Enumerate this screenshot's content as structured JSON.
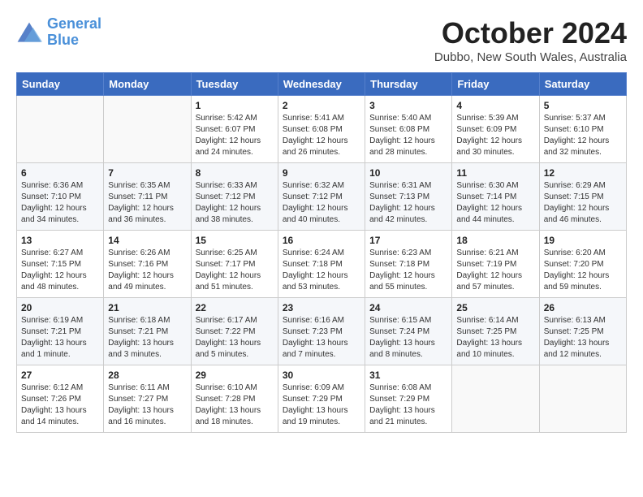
{
  "logo": {
    "line1": "General",
    "line2": "Blue"
  },
  "title": "October 2024",
  "location": "Dubbo, New South Wales, Australia",
  "headers": [
    "Sunday",
    "Monday",
    "Tuesday",
    "Wednesday",
    "Thursday",
    "Friday",
    "Saturday"
  ],
  "weeks": [
    [
      {
        "day": "",
        "sunrise": "",
        "sunset": "",
        "daylight": ""
      },
      {
        "day": "",
        "sunrise": "",
        "sunset": "",
        "daylight": ""
      },
      {
        "day": "1",
        "sunrise": "Sunrise: 5:42 AM",
        "sunset": "Sunset: 6:07 PM",
        "daylight": "Daylight: 12 hours and 24 minutes."
      },
      {
        "day": "2",
        "sunrise": "Sunrise: 5:41 AM",
        "sunset": "Sunset: 6:08 PM",
        "daylight": "Daylight: 12 hours and 26 minutes."
      },
      {
        "day": "3",
        "sunrise": "Sunrise: 5:40 AM",
        "sunset": "Sunset: 6:08 PM",
        "daylight": "Daylight: 12 hours and 28 minutes."
      },
      {
        "day": "4",
        "sunrise": "Sunrise: 5:39 AM",
        "sunset": "Sunset: 6:09 PM",
        "daylight": "Daylight: 12 hours and 30 minutes."
      },
      {
        "day": "5",
        "sunrise": "Sunrise: 5:37 AM",
        "sunset": "Sunset: 6:10 PM",
        "daylight": "Daylight: 12 hours and 32 minutes."
      }
    ],
    [
      {
        "day": "6",
        "sunrise": "Sunrise: 6:36 AM",
        "sunset": "Sunset: 7:10 PM",
        "daylight": "Daylight: 12 hours and 34 minutes."
      },
      {
        "day": "7",
        "sunrise": "Sunrise: 6:35 AM",
        "sunset": "Sunset: 7:11 PM",
        "daylight": "Daylight: 12 hours and 36 minutes."
      },
      {
        "day": "8",
        "sunrise": "Sunrise: 6:33 AM",
        "sunset": "Sunset: 7:12 PM",
        "daylight": "Daylight: 12 hours and 38 minutes."
      },
      {
        "day": "9",
        "sunrise": "Sunrise: 6:32 AM",
        "sunset": "Sunset: 7:12 PM",
        "daylight": "Daylight: 12 hours and 40 minutes."
      },
      {
        "day": "10",
        "sunrise": "Sunrise: 6:31 AM",
        "sunset": "Sunset: 7:13 PM",
        "daylight": "Daylight: 12 hours and 42 minutes."
      },
      {
        "day": "11",
        "sunrise": "Sunrise: 6:30 AM",
        "sunset": "Sunset: 7:14 PM",
        "daylight": "Daylight: 12 hours and 44 minutes."
      },
      {
        "day": "12",
        "sunrise": "Sunrise: 6:29 AM",
        "sunset": "Sunset: 7:15 PM",
        "daylight": "Daylight: 12 hours and 46 minutes."
      }
    ],
    [
      {
        "day": "13",
        "sunrise": "Sunrise: 6:27 AM",
        "sunset": "Sunset: 7:15 PM",
        "daylight": "Daylight: 12 hours and 48 minutes."
      },
      {
        "day": "14",
        "sunrise": "Sunrise: 6:26 AM",
        "sunset": "Sunset: 7:16 PM",
        "daylight": "Daylight: 12 hours and 49 minutes."
      },
      {
        "day": "15",
        "sunrise": "Sunrise: 6:25 AM",
        "sunset": "Sunset: 7:17 PM",
        "daylight": "Daylight: 12 hours and 51 minutes."
      },
      {
        "day": "16",
        "sunrise": "Sunrise: 6:24 AM",
        "sunset": "Sunset: 7:18 PM",
        "daylight": "Daylight: 12 hours and 53 minutes."
      },
      {
        "day": "17",
        "sunrise": "Sunrise: 6:23 AM",
        "sunset": "Sunset: 7:18 PM",
        "daylight": "Daylight: 12 hours and 55 minutes."
      },
      {
        "day": "18",
        "sunrise": "Sunrise: 6:21 AM",
        "sunset": "Sunset: 7:19 PM",
        "daylight": "Daylight: 12 hours and 57 minutes."
      },
      {
        "day": "19",
        "sunrise": "Sunrise: 6:20 AM",
        "sunset": "Sunset: 7:20 PM",
        "daylight": "Daylight: 12 hours and 59 minutes."
      }
    ],
    [
      {
        "day": "20",
        "sunrise": "Sunrise: 6:19 AM",
        "sunset": "Sunset: 7:21 PM",
        "daylight": "Daylight: 13 hours and 1 minute."
      },
      {
        "day": "21",
        "sunrise": "Sunrise: 6:18 AM",
        "sunset": "Sunset: 7:21 PM",
        "daylight": "Daylight: 13 hours and 3 minutes."
      },
      {
        "day": "22",
        "sunrise": "Sunrise: 6:17 AM",
        "sunset": "Sunset: 7:22 PM",
        "daylight": "Daylight: 13 hours and 5 minutes."
      },
      {
        "day": "23",
        "sunrise": "Sunrise: 6:16 AM",
        "sunset": "Sunset: 7:23 PM",
        "daylight": "Daylight: 13 hours and 7 minutes."
      },
      {
        "day": "24",
        "sunrise": "Sunrise: 6:15 AM",
        "sunset": "Sunset: 7:24 PM",
        "daylight": "Daylight: 13 hours and 8 minutes."
      },
      {
        "day": "25",
        "sunrise": "Sunrise: 6:14 AM",
        "sunset": "Sunset: 7:25 PM",
        "daylight": "Daylight: 13 hours and 10 minutes."
      },
      {
        "day": "26",
        "sunrise": "Sunrise: 6:13 AM",
        "sunset": "Sunset: 7:25 PM",
        "daylight": "Daylight: 13 hours and 12 minutes."
      }
    ],
    [
      {
        "day": "27",
        "sunrise": "Sunrise: 6:12 AM",
        "sunset": "Sunset: 7:26 PM",
        "daylight": "Daylight: 13 hours and 14 minutes."
      },
      {
        "day": "28",
        "sunrise": "Sunrise: 6:11 AM",
        "sunset": "Sunset: 7:27 PM",
        "daylight": "Daylight: 13 hours and 16 minutes."
      },
      {
        "day": "29",
        "sunrise": "Sunrise: 6:10 AM",
        "sunset": "Sunset: 7:28 PM",
        "daylight": "Daylight: 13 hours and 18 minutes."
      },
      {
        "day": "30",
        "sunrise": "Sunrise: 6:09 AM",
        "sunset": "Sunset: 7:29 PM",
        "daylight": "Daylight: 13 hours and 19 minutes."
      },
      {
        "day": "31",
        "sunrise": "Sunrise: 6:08 AM",
        "sunset": "Sunset: 7:29 PM",
        "daylight": "Daylight: 13 hours and 21 minutes."
      },
      {
        "day": "",
        "sunrise": "",
        "sunset": "",
        "daylight": ""
      },
      {
        "day": "",
        "sunrise": "",
        "sunset": "",
        "daylight": ""
      }
    ]
  ]
}
